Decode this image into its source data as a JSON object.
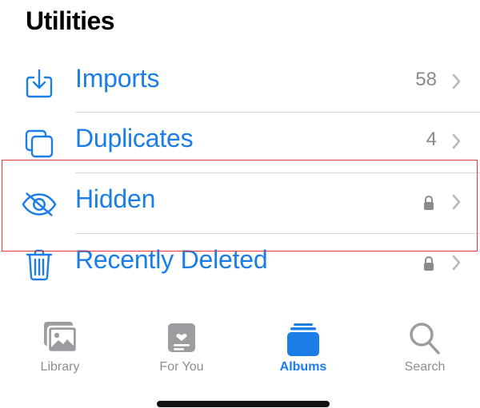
{
  "section": {
    "title": "Utilities"
  },
  "rows": [
    {
      "label": "Imports",
      "count": "58",
      "icon": "import-icon"
    },
    {
      "label": "Duplicates",
      "count": "4",
      "icon": "duplicates-icon"
    },
    {
      "label": "Hidden",
      "locked": true,
      "icon": "hidden-eye-icon"
    },
    {
      "label": "Recently Deleted",
      "locked": true,
      "icon": "trash-icon"
    }
  ],
  "tabs": [
    {
      "label": "Library",
      "icon": "photo-library-icon"
    },
    {
      "label": "For You",
      "icon": "for-you-icon"
    },
    {
      "label": "Albums",
      "icon": "albums-icon",
      "active": true
    },
    {
      "label": "Search",
      "icon": "search-icon"
    }
  ],
  "colors": {
    "accent": "#1a7ee6",
    "secondary_text": "#8a8a8e",
    "highlight_box": "#e53a3a"
  }
}
